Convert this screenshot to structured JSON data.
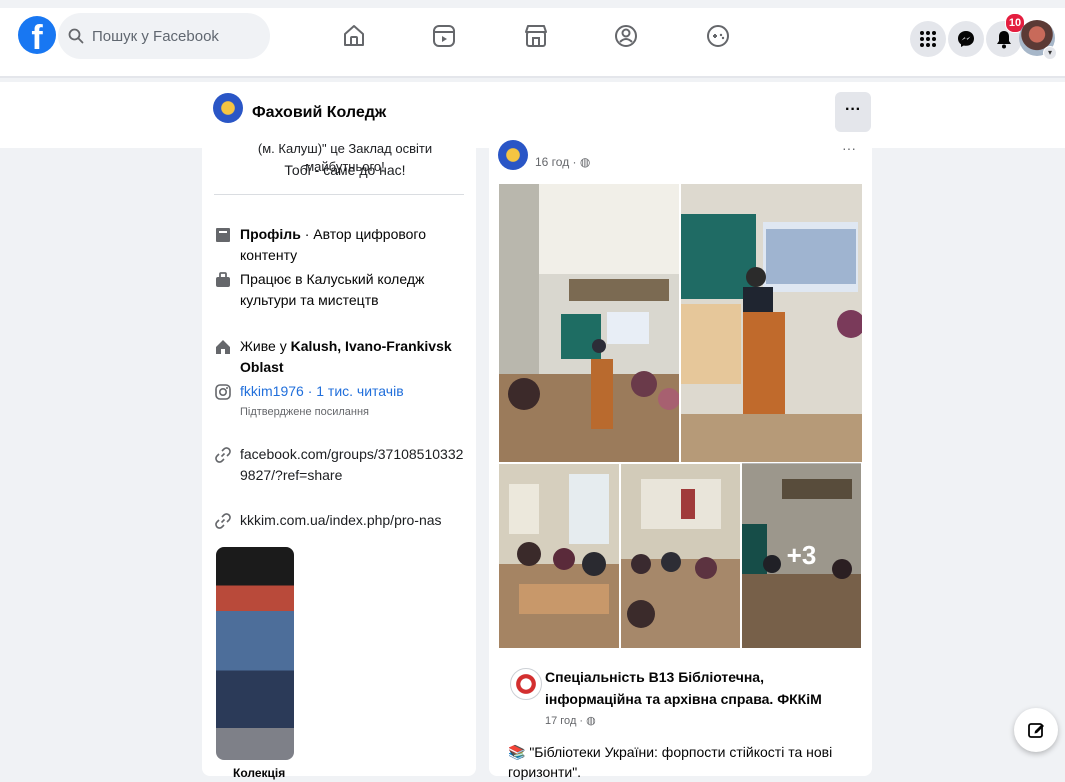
{
  "header": {
    "logo_letter": "f",
    "search_placeholder": "Пошук у Facebook",
    "notification_count": "10"
  },
  "page": {
    "name": "Фаховий Коледж",
    "more_label": "···"
  },
  "intro": {
    "line_cut": "(м. Калуш)\" це Заклад освіти майбутнього!",
    "line2": "Тобі - саме до нас!"
  },
  "details": {
    "profile_bold": "Профіль",
    "profile_rest": " · Автор цифрового контенту",
    "work": "Працює в Калуський коледж культури та мистецтв",
    "lives_prefix": "Живе у ",
    "lives_place": "Kalush, Ivano-Frankivsk Oblast",
    "instagram": "fkkim1976 · 1 тис. читачів",
    "instagram_sub": "Підтверджене посилання",
    "link1": "facebook.com/groups/371085103329827/?ref=share",
    "link2": "kkkim.com.ua/index.php/pro-nas"
  },
  "story": {
    "label": "Колекція"
  },
  "post": {
    "time": "16 год · ",
    "dots": "···",
    "more_photos": "+3",
    "shared_title": "Спеціальність В13 Бібліотечна, інформаційна та архівна справа. ФККіМ",
    "shared_time": "17 год · ",
    "shared_text": "\"Бібліотеки України: форпости стійкості та нові горизонти\"."
  },
  "colors": {
    "brand": "#1877f2",
    "badge": "#e41e3f",
    "link_blue": "#216fdb",
    "background": "#f0f2f5"
  }
}
